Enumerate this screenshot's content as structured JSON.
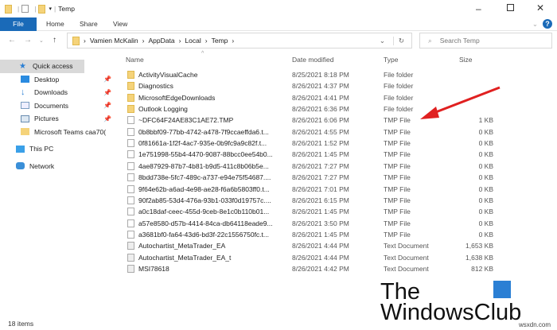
{
  "window": {
    "title": "Temp"
  },
  "ribbon": {
    "file": "File",
    "tabs": [
      "Home",
      "Share",
      "View"
    ],
    "help": "?"
  },
  "address": {
    "crumbs": [
      "Vamien McKalin",
      "AppData",
      "Local",
      "Temp"
    ],
    "search_placeholder": "Search Temp"
  },
  "sidebar": {
    "items": [
      {
        "label": "Quick access",
        "icon": "star-icon",
        "pinned": false
      },
      {
        "label": "Desktop",
        "icon": "desktop-icon",
        "pinned": true
      },
      {
        "label": "Downloads",
        "icon": "download-icon",
        "pinned": true
      },
      {
        "label": "Documents",
        "icon": "documents-icon",
        "pinned": true
      },
      {
        "label": "Pictures",
        "icon": "pictures-icon",
        "pinned": true
      },
      {
        "label": "Microsoft Teams caa70(",
        "icon": "folder-icon",
        "pinned": false
      },
      {
        "label": "This PC",
        "icon": "pc-icon",
        "pinned": false
      },
      {
        "label": "Network",
        "icon": "network-icon",
        "pinned": false
      }
    ]
  },
  "columns": {
    "name": "Name",
    "date": "Date modified",
    "type": "Type",
    "size": "Size"
  },
  "files": [
    {
      "name": "ActivityVisualCache",
      "date": "8/25/2021 8:18 PM",
      "type": "File folder",
      "size": "",
      "kind": "folder"
    },
    {
      "name": "Diagnostics",
      "date": "8/26/2021 4:37 PM",
      "type": "File folder",
      "size": "",
      "kind": "folder"
    },
    {
      "name": "MicrosoftEdgeDownloads",
      "date": "8/26/2021 4:41 PM",
      "type": "File folder",
      "size": "",
      "kind": "folder"
    },
    {
      "name": "Outlook Logging",
      "date": "8/26/2021 6:36 PM",
      "type": "File folder",
      "size": "",
      "kind": "folder"
    },
    {
      "name": "~DFC64F24AE83C1AE72.TMP",
      "date": "8/26/2021 6:06 PM",
      "type": "TMP File",
      "size": "1 KB",
      "kind": "file"
    },
    {
      "name": "0b8bbf09-77bb-4742-a478-7f9ccaeffda6.t...",
      "date": "8/26/2021 4:55 PM",
      "type": "TMP File",
      "size": "0 KB",
      "kind": "file"
    },
    {
      "name": "0f81661a-1f2f-4ac7-935e-0b9fc9a9c82f.t...",
      "date": "8/26/2021 1:52 PM",
      "type": "TMP File",
      "size": "0 KB",
      "kind": "file"
    },
    {
      "name": "1e751998-55b4-4470-9087-88bcc0ee54b0...",
      "date": "8/26/2021 1:45 PM",
      "type": "TMP File",
      "size": "0 KB",
      "kind": "file"
    },
    {
      "name": "4ae87929-87b7-4b81-b9d5-411c8b06b5e...",
      "date": "8/26/2021 7:27 PM",
      "type": "TMP File",
      "size": "0 KB",
      "kind": "file"
    },
    {
      "name": "8bdd738e-5fc7-489c-a737-e94e75f54687....",
      "date": "8/26/2021 7:27 PM",
      "type": "TMP File",
      "size": "0 KB",
      "kind": "file"
    },
    {
      "name": "9f64e62b-a6ad-4e98-ae28-f6a6b5803ff0.t...",
      "date": "8/26/2021 7:01 PM",
      "type": "TMP File",
      "size": "0 KB",
      "kind": "file"
    },
    {
      "name": "90f2ab85-53d4-476a-93b1-033f0d19757c....",
      "date": "8/26/2021 6:15 PM",
      "type": "TMP File",
      "size": "0 KB",
      "kind": "file"
    },
    {
      "name": "a0c18daf-ceec-455d-9ceb-8e1c0b110b01...",
      "date": "8/26/2021 1:45 PM",
      "type": "TMP File",
      "size": "0 KB",
      "kind": "file"
    },
    {
      "name": "a57e8580-d57b-4414-84ca-db64118eade9...",
      "date": "8/26/2021 3:50 PM",
      "type": "TMP File",
      "size": "0 KB",
      "kind": "file"
    },
    {
      "name": "a3681bf0-fa64-43d6-bd3f-22c1556750fc.t...",
      "date": "8/26/2021 1:45 PM",
      "type": "TMP File",
      "size": "0 KB",
      "kind": "file"
    },
    {
      "name": "Autochartist_MetaTrader_EA",
      "date": "8/26/2021 4:44 PM",
      "type": "Text Document",
      "size": "1,653 KB",
      "kind": "text"
    },
    {
      "name": "Autochartist_MetaTrader_EA_t",
      "date": "8/26/2021 4:44 PM",
      "type": "Text Document",
      "size": "1,638 KB",
      "kind": "text"
    },
    {
      "name": "MSI78618",
      "date": "8/26/2021 4:42 PM",
      "type": "Text Document",
      "size": "812 KB",
      "kind": "text"
    }
  ],
  "status": {
    "count": "18 items"
  },
  "watermark": {
    "line1": "The",
    "line2": "WindowsClub",
    "site": "wsxdn.com"
  },
  "colors": {
    "accent": "#1a6ab8",
    "arrow": "#e02020"
  }
}
